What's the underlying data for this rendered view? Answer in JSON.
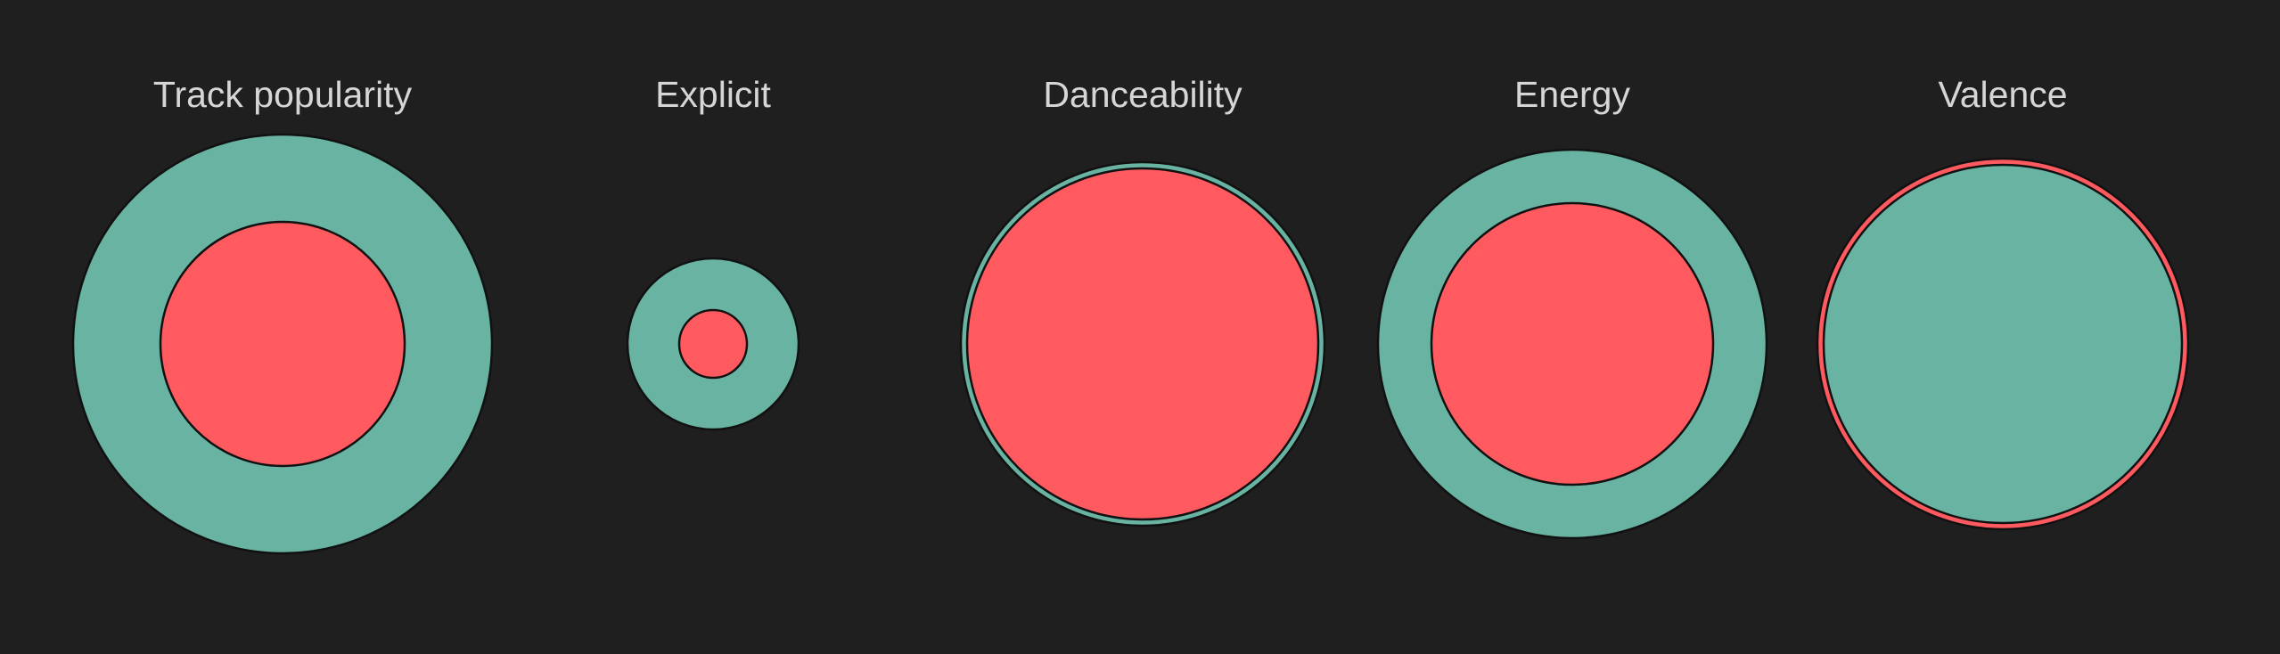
{
  "colors": {
    "background": "#1f1f1f",
    "teal": "#69b3a2",
    "red": "#ff5a5f",
    "title_text": "#d6d6d6",
    "stroke": "#111111"
  },
  "chart_data": {
    "type": "nested-circles",
    "grid": false,
    "legend": "none",
    "panels": [
      {
        "title": "Track popularity",
        "circles": [
          {
            "color": "teal",
            "value": 235
          },
          {
            "color": "red",
            "value": 137
          }
        ]
      },
      {
        "title": "Explicit",
        "circles": [
          {
            "color": "teal",
            "value": 96
          },
          {
            "color": "red",
            "value": 38
          }
        ]
      },
      {
        "title": "Danceability",
        "circles": [
          {
            "color": "teal",
            "value": 204
          },
          {
            "color": "red",
            "value": 197
          }
        ]
      },
      {
        "title": "Energy",
        "circles": [
          {
            "color": "teal",
            "value": 218
          },
          {
            "color": "red",
            "value": 158
          }
        ]
      },
      {
        "title": "Valence",
        "circles": [
          {
            "color": "red",
            "value": 208
          },
          {
            "color": "teal",
            "value": 201
          }
        ]
      }
    ]
  }
}
